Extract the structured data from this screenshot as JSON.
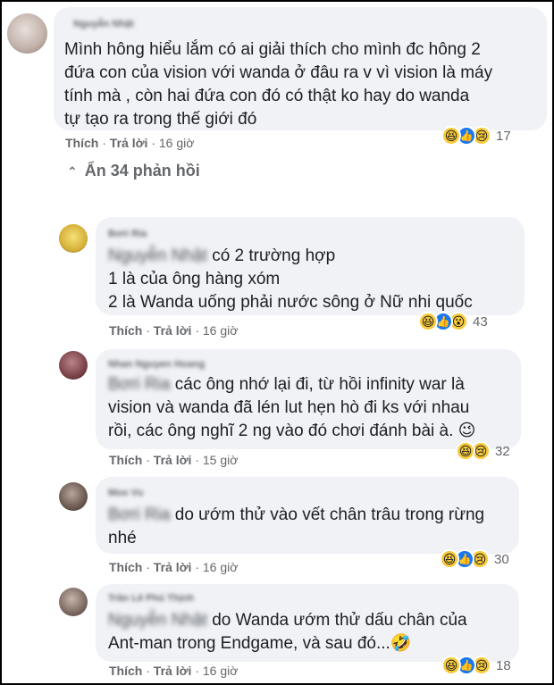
{
  "comments": [
    {
      "author": "Nguyễn Nhật",
      "lines": [
        "Mình hông hiểu lắm có ai giải thích cho mình đc hông 2",
        "đứa con của vision với wanda ở đâu ra v vì vision là máy",
        "tính mà , còn hai đứa con đó có thật ko hay do wanda",
        "tự tạo ra trong thế giới đó"
      ],
      "like": "Thích",
      "reply": "Trả lời",
      "time": "16 giờ",
      "reaction_count": "17",
      "reactions": [
        "haha",
        "like",
        "sad"
      ]
    }
  ],
  "toggle_label": "Ẩn 34 phản hồi",
  "replies": [
    {
      "author": "Bơri Ria",
      "tag": "Nguyễn Nhật",
      "lines": [
        "có 2 trường hợp",
        "1 là của ông hàng xóm",
        "2 là Wanda uống phải nước sông ở Nữ nhi quốc"
      ],
      "like": "Thích",
      "reply": "Trả lời",
      "time": "16 giờ",
      "reaction_count": "43",
      "reactions": [
        "haha",
        "like",
        "wow"
      ]
    },
    {
      "author": "Nhan Nguyen Hoang",
      "tag": "Bơri Ria",
      "lines": [
        "các ông nhớ lại đi, từ hồi infinity war là",
        "vision và wanda đã lén lut hẹn hò đi ks với nhau",
        "rồi, các ông nghĩ 2 ng vào đó chơi đánh bài à. 😉"
      ],
      "like": "Thích",
      "reply": "Trả lời",
      "time": "15 giờ",
      "reaction_count": "32",
      "reactions": [
        "haha",
        "sad"
      ]
    },
    {
      "author": "Moo Vu",
      "tag": "Bơri Ria",
      "lines": [
        "do ướm thử vào vết chân trâu trong rừng",
        "nhé"
      ],
      "like": "Thích",
      "reply": "Trả lời",
      "time": "16 giờ",
      "reaction_count": "30",
      "reactions": [
        "haha",
        "like",
        "sad"
      ]
    },
    {
      "author": "Trần Lê Phú Thịnh",
      "tag": "Nguyễn Nhật",
      "lines": [
        "do Wanda ướm thử dấu chân của",
        "Ant-man trong Endgame, và sau đó...🤣"
      ],
      "like": "Thích",
      "reply": "Trả lời",
      "time": "16 giờ",
      "reaction_count": "18",
      "reactions": [
        "haha",
        "like",
        "sad"
      ]
    }
  ],
  "icons": {
    "haha": "😆",
    "like": "👍",
    "sad": "😢",
    "wow": "😮",
    "chevron": "⌃"
  }
}
